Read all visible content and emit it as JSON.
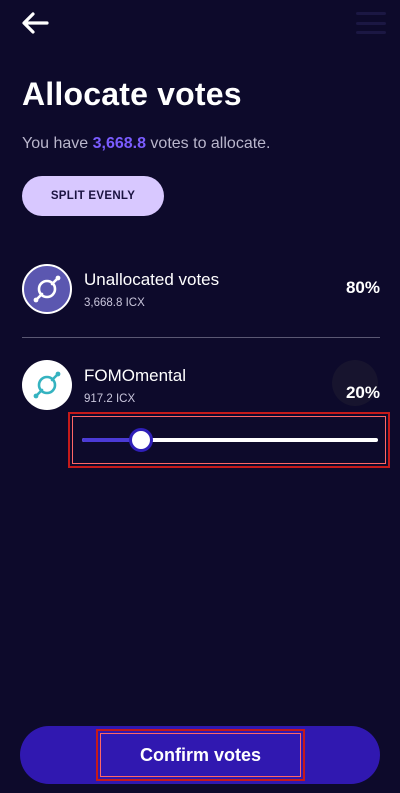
{
  "header": {
    "back_icon": "arrow-left-icon",
    "menu_icon": "hamburger-menu-icon",
    "title": "Allocate votes"
  },
  "summary": {
    "prefix": "You have ",
    "amount": "3,668.8",
    "suffix": " votes to allocate."
  },
  "actions": {
    "split_label": "SPLIT EVENLY",
    "confirm_label": "Confirm votes"
  },
  "allocations": [
    {
      "name": "Unallocated votes",
      "amount": "3,668.8 ICX",
      "percent": "80%",
      "icon": "icon-logo-icon"
    },
    {
      "name": "FOMOmental",
      "amount": "917.2 ICX",
      "percent": "20%",
      "icon": "icon-logo-icon",
      "slider_value": 0.2
    }
  ],
  "colors": {
    "background": "#0d0a2b",
    "accent": "#7a5cff",
    "button_light": "#d8c8ff",
    "confirm": "#3018b0"
  }
}
